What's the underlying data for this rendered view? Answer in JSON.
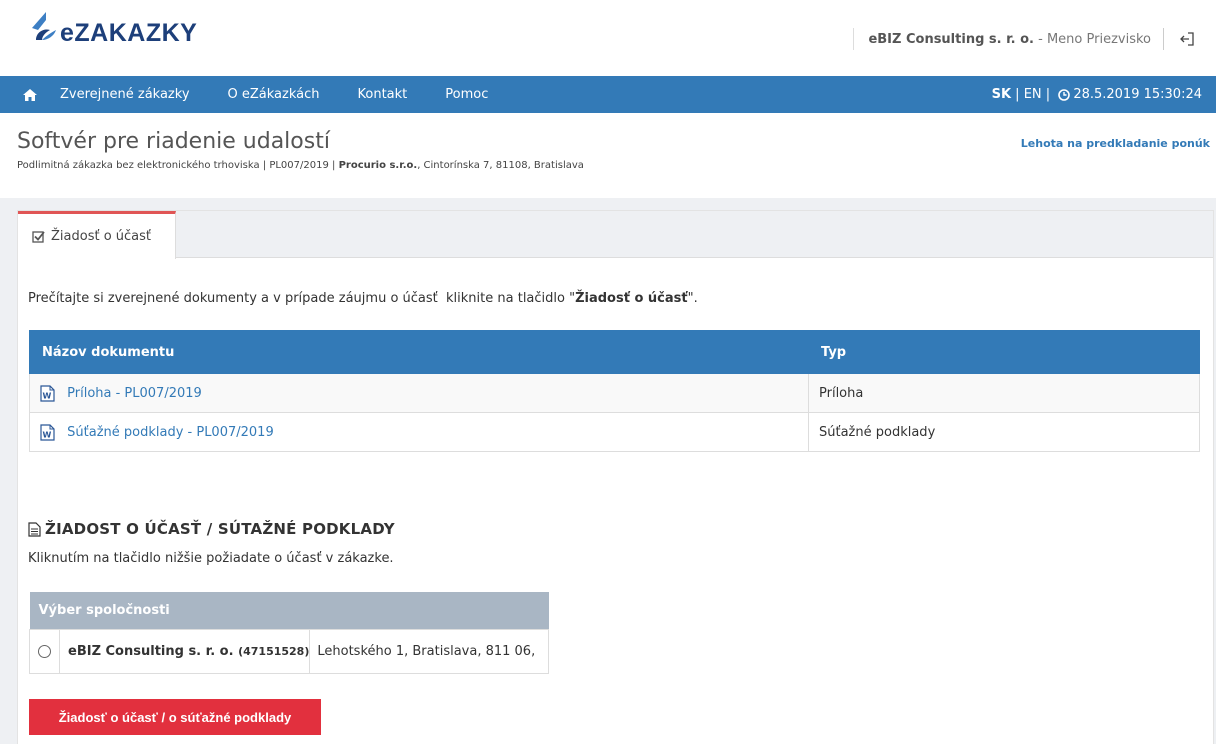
{
  "header": {
    "logo_text": "eZAKAZKY",
    "company": "eBIZ Consulting s. r. o.",
    "user_separator": " - ",
    "user_name": "Meno Priezvisko"
  },
  "nav": {
    "items": [
      "Zverejnené zákazky",
      "O eZákazkách",
      "Kontakt",
      "Pomoc"
    ],
    "lang_sk": "SK",
    "lang_sep": " | ",
    "lang_en": "EN",
    "lang_sep2": " | ",
    "datetime": "28.5.2019 15:30:24"
  },
  "page": {
    "title": "Softvér pre riadenie udalostí",
    "subtitle_prefix": "Podlimitná zákazka bez elektronického trhoviska | PL007/2019 | ",
    "subtitle_org": "Procurio s.r.o.",
    "subtitle_suffix": ", Cintorínska 7, 81108, Bratislava",
    "deadline_label": "Lehota na predkladanie ponúk"
  },
  "tab": {
    "label": "Žiadosť o účasť"
  },
  "intro": {
    "text_before": "Prečítajte si zverejnené dokumenty a v prípade záujmu o účasť  kliknite na tlačidlo \"",
    "text_bold": "Žiadosť o účasť",
    "text_after": "\"."
  },
  "documents": {
    "col_name": "Názov dokumentu",
    "col_type": "Typ",
    "rows": [
      {
        "name": "Príloha - PL007/2019",
        "type": "Príloha"
      },
      {
        "name": "Súťažné podklady - PL007/2019",
        "type": "Súťažné podklady"
      }
    ]
  },
  "request": {
    "title": "ŽIADOST O ÚČASŤ / SÚTAŽNÉ PODKLADY",
    "description": "Kliknutím na tlačidlo nižšie požiadate o účasť v zákazke.",
    "company_table_header": "Výber spoločnosti",
    "company_name": "eBIZ Consulting s. r. o.",
    "company_id": "(47151528)",
    "company_address": "Lehotského 1, Bratislava, 811 06,",
    "button_label": "Žiadosť o účasť / o súťažné podklady"
  },
  "colors": {
    "primary": "#337ab7",
    "danger": "#e2303e",
    "tab_accent": "#e05555",
    "table_header_gray": "#a9b6c4"
  }
}
